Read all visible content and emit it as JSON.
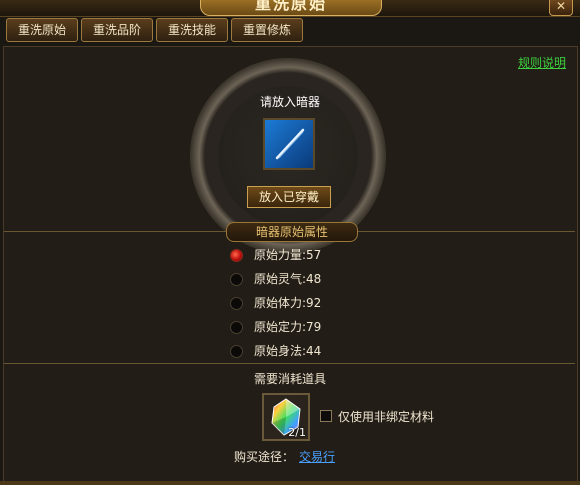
{
  "window": {
    "title": "重洗原始",
    "close_glyph": "✕"
  },
  "tabs": [
    {
      "label": "重洗原始"
    },
    {
      "label": "重洗品阶"
    },
    {
      "label": "重洗技能"
    },
    {
      "label": "重置修炼"
    }
  ],
  "rules_link": "规则说明",
  "slot": {
    "prompt": "请放入暗器",
    "insert_button": "放入已穿戴",
    "icon": "needle-weapon-icon"
  },
  "attributes": {
    "header": "暗器原始属性",
    "items": [
      {
        "label": "原始力量:57",
        "selected": true
      },
      {
        "label": "原始灵气:48",
        "selected": false
      },
      {
        "label": "原始体力:92",
        "selected": false
      },
      {
        "label": "原始定力:79",
        "selected": false
      },
      {
        "label": "原始身法:44",
        "selected": false
      }
    ]
  },
  "material": {
    "label": "需要消耗道具",
    "count": "2/1",
    "icon": "rainbow-crystal-icon",
    "checkbox_label": "仅使用非绑定材料",
    "checkbox_checked": false
  },
  "purchase": {
    "label": "购买途径：",
    "link": "交易行"
  }
}
